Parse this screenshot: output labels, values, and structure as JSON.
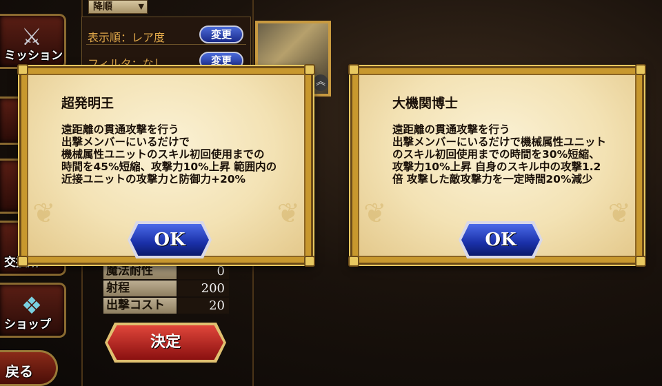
{
  "sidebar": {
    "items": [
      {
        "label": "ミッション"
      },
      {
        "label": "交換所"
      },
      {
        "label": "ショップ"
      }
    ],
    "back_label": "戻る"
  },
  "sort": {
    "order_label": "降順"
  },
  "filters": [
    {
      "text": "表示順：レア度",
      "button": "変更"
    },
    {
      "text": "フィルタ：なし",
      "button": "変更"
    }
  ],
  "stats": [
    {
      "label": "魔法耐性",
      "value": "0"
    },
    {
      "label": "射程",
      "value": "200"
    },
    {
      "label": "出撃コスト",
      "value": "20"
    }
  ],
  "decide_label": "決定",
  "dialogs": [
    {
      "title": "超発明王",
      "lines": [
        "遠距離の貫通攻撃を行う",
        "出撃メンバーにいるだけで",
        "機械属性ユニットのスキル初回使用までの",
        "時間を45%短縮、攻撃力10%上昇 範囲内の",
        "近接ユニットの攻撃力と防御力+20%"
      ],
      "ok_label": "OK"
    },
    {
      "title": "大機関博士",
      "lines": [
        "遠距離の貫通攻撃を行う",
        "出撃メンバーにいるだけで機械属性ユニット",
        "のスキル初回使用までの時間を30%短縮、",
        "攻撃力10%上昇 自身のスキル中の攻撃1.2",
        "倍 攻撃した敵攻撃力を一定時間20%減少"
      ],
      "ok_label": "OK"
    }
  ],
  "colors": {
    "ok_button": "#1a30a8",
    "change_button": "#2a3aa8",
    "decide_button": "#b01c16",
    "parchment": "#f3e2b4"
  }
}
